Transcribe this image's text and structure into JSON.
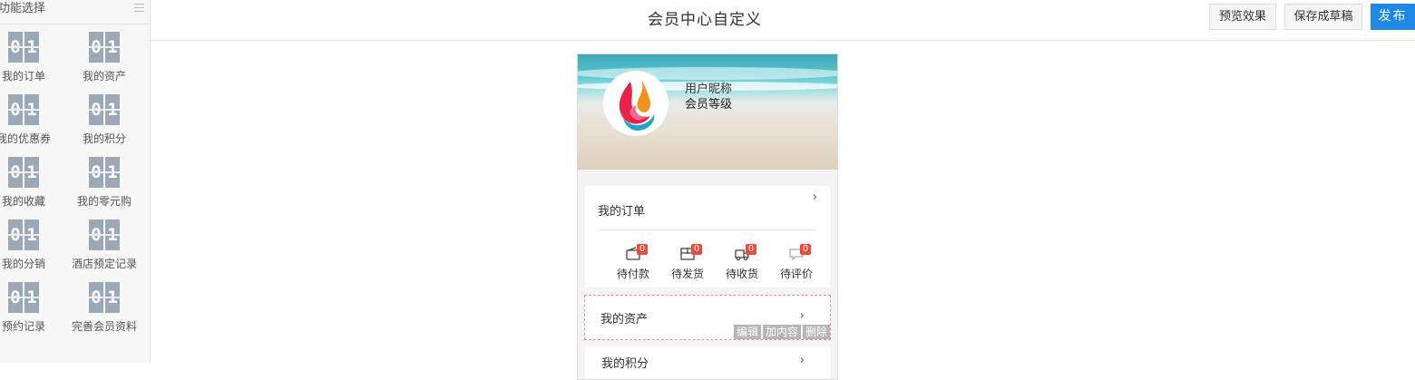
{
  "sidebar": {
    "title": "功能选择",
    "menu_icon": "list-icon",
    "tiles": [
      {
        "label": "我的订单",
        "icon": "01"
      },
      {
        "label": "我的资产",
        "icon": "01"
      },
      {
        "label": "我的优惠券",
        "icon": "01"
      },
      {
        "label": "我的积分",
        "icon": "01"
      },
      {
        "label": "我的收藏",
        "icon": "01"
      },
      {
        "label": "我的零元购",
        "icon": "01"
      },
      {
        "label": "我的分销",
        "icon": "01"
      },
      {
        "label": "酒店预定记录",
        "icon": "01"
      },
      {
        "label": "预约记录",
        "icon": "01"
      },
      {
        "label": "完善会员资料",
        "icon": "01"
      }
    ]
  },
  "header": {
    "title": "会员中心自定义",
    "preview_label": "预览效果",
    "draft_label": "保存成草稿",
    "publish_label": "发布",
    "accent": "#1e88e5"
  },
  "phone": {
    "nickname": "用户昵称",
    "level": "会员等级",
    "orders": {
      "title": "我的订单",
      "statuses": [
        {
          "label": "待付款",
          "count": "0",
          "icon": "wallet-icon"
        },
        {
          "label": "待发货",
          "count": "0",
          "icon": "package-icon"
        },
        {
          "label": "待收货",
          "count": "0",
          "icon": "truck-icon"
        },
        {
          "label": "待评价",
          "count": "0",
          "icon": "comment-icon"
        }
      ]
    },
    "assets": {
      "title": "我的资产",
      "tools": [
        "编辑",
        "加内容",
        "删除"
      ]
    },
    "points": {
      "title": "我的积分"
    }
  }
}
